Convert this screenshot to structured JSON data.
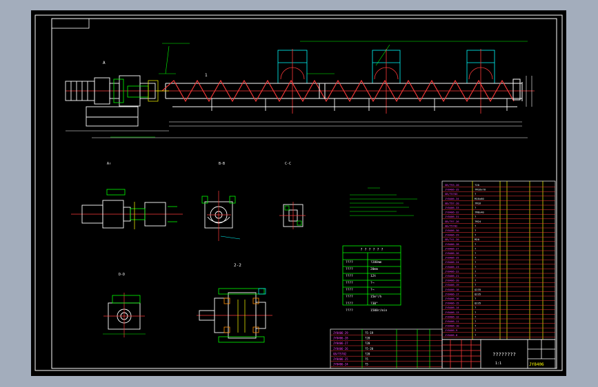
{
  "views": {
    "view_a": "A",
    "section_1": "1",
    "view_a_label": "A↑",
    "view_bb": "B-B",
    "view_cc": "C-C",
    "view_dd": "D-D",
    "section_22": "2-2"
  },
  "drawing": {
    "code": "JY8406",
    "scale": "1:1",
    "title_glyphs": "????????"
  },
  "specs": {
    "rows": [
      {
        "label": "????",
        "value": "?280mm"
      },
      {
        "label": "????",
        "value": "20mm"
      },
      {
        "label": "????",
        "value": "12t"
      },
      {
        "label": "????",
        "value": "?¬"
      },
      {
        "label": "????",
        "value": "?¬"
      },
      {
        "label": "????",
        "value": "15m³/h"
      },
      {
        "label": "????",
        "value": "?30°"
      },
      {
        "label": "????",
        "value": "1500r/min"
      }
    ]
  },
  "parts": {
    "left_codes": [
      "JY8406-29",
      "JY8406-28",
      "JY8406-27",
      "JY8406-26",
      "GB/T5782",
      "JY8406-25",
      "JY8406-24"
    ],
    "left_names": [
      "?5-19",
      "?20",
      "?20",
      "?5-20",
      "?20",
      "?5",
      "?5"
    ],
    "right_codes": [
      "GB/T93-20",
      "JY8406-35",
      "GB/T5783",
      "JY8406-34",
      "GB/T97-20",
      "JY8406-33",
      "JY8406-32",
      "JY8406-31",
      "GB/T97-26",
      "GB/T5782",
      "JY8406-30",
      "JY8406-29",
      "GB/T41-20",
      "JY8406-28",
      "JY8406-27",
      "JY8406-26",
      "JY8406-25",
      "JY8406-24",
      "JY8406-23",
      "JY8406-22",
      "JY8406-21",
      "JY8406-20",
      "JY8406-19",
      "JY8406-18",
      "JY8406-17",
      "JY8406-16",
      "JY8406-15",
      "JY8406-14",
      "JY8406-13",
      "JY8406-12",
      "JY8406-11",
      "JY8406-10",
      "JY8406-9",
      "JY8406-8"
    ],
    "right_names": [
      "?20",
      "?M16x70",
      "?",
      "M16x60",
      "?M16",
      "?",
      "?M8x40",
      "?",
      "?M24",
      "?",
      "?",
      "?",
      "M20",
      "?",
      "?",
      "?",
      "?",
      "?",
      "?",
      "?",
      "?",
      "?",
      "?",
      "Q235",
      "Q235",
      "?",
      "Q235",
      "?",
      "?",
      "?",
      "?",
      "?",
      "?",
      "?"
    ]
  }
}
